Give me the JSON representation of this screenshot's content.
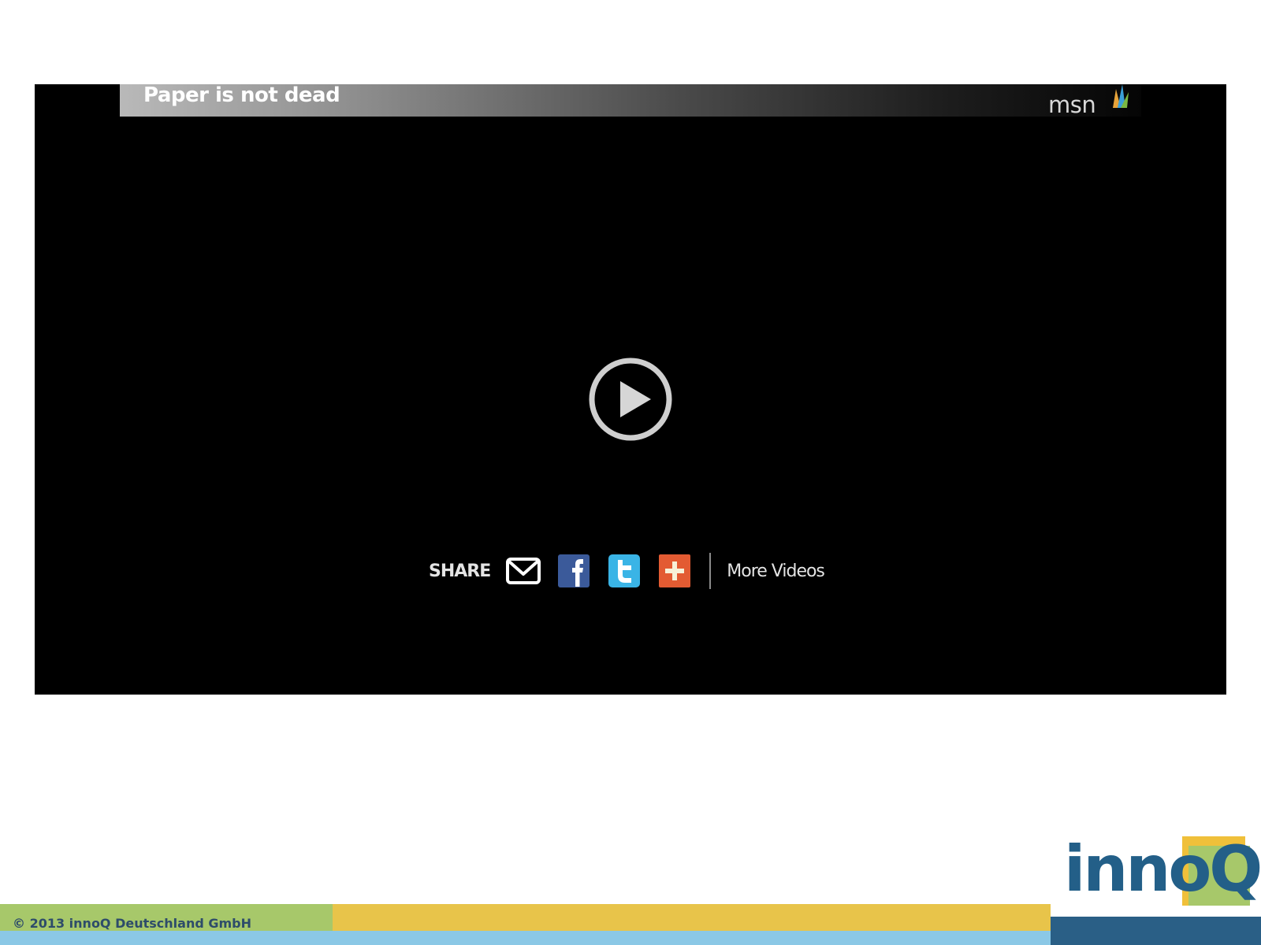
{
  "player": {
    "title": "Paper is not dead",
    "brand": "msn",
    "share_label": "SHARE",
    "share_icons": [
      "envelope-icon",
      "facebook-icon",
      "twitter-icon",
      "plus-icon"
    ],
    "more_videos_label": "More Videos"
  },
  "footer": {
    "copyright": "© 2013 innoQ Deutschland GmbH",
    "logo_text": "innoQ"
  },
  "colors": {
    "player_background": "#000000",
    "footer_green": "#a7c86a",
    "footer_yellow": "#e8c44a",
    "footer_lightblue": "#8bc8e6",
    "footer_darkblue": "#2a5f86",
    "logo_blue": "#235f88",
    "facebook_blue": "#3b5a9a",
    "twitter_blue": "#3ab4e6",
    "plus_orange": "#e35b32"
  }
}
